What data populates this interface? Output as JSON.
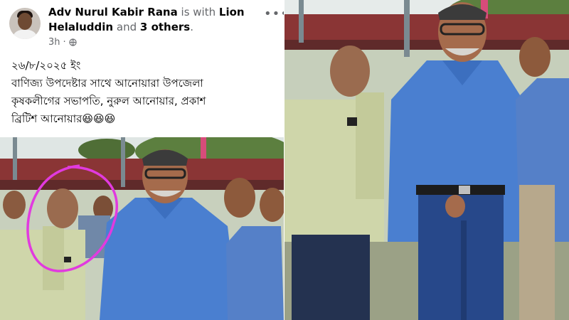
{
  "post": {
    "author": "Adv Nurul Kabir Rana",
    "with_word": "is with",
    "tagged_person": "Lion Helaluddin",
    "and_word": "and",
    "others": "3 others",
    "time": "3h",
    "privacy_icon": "globe-icon",
    "more_icon": "more-options-icon",
    "more_label": "•••",
    "text_lines": [
      "২৬/৮/২০২৫ ইং",
      "বাণিজ্য উপদেষ্টার সাথে আনোয়ারা উপজেলা",
      "কৃষকলীগের সভাপতি, নুরুল আনোয়ার, প্রকাশ",
      "ব্রিটিশ আনোয়ার😆😆😆"
    ]
  },
  "photos": {
    "left": "post-photo-crop",
    "right": "post-photo-zoomed",
    "highlight_color": "#e13adf"
  },
  "colors": {
    "name_text": "#050505",
    "secondary_text": "#65676b",
    "shirt_blue": "#4a7fd0",
    "shirt_khaki": "#cfd6aa"
  }
}
